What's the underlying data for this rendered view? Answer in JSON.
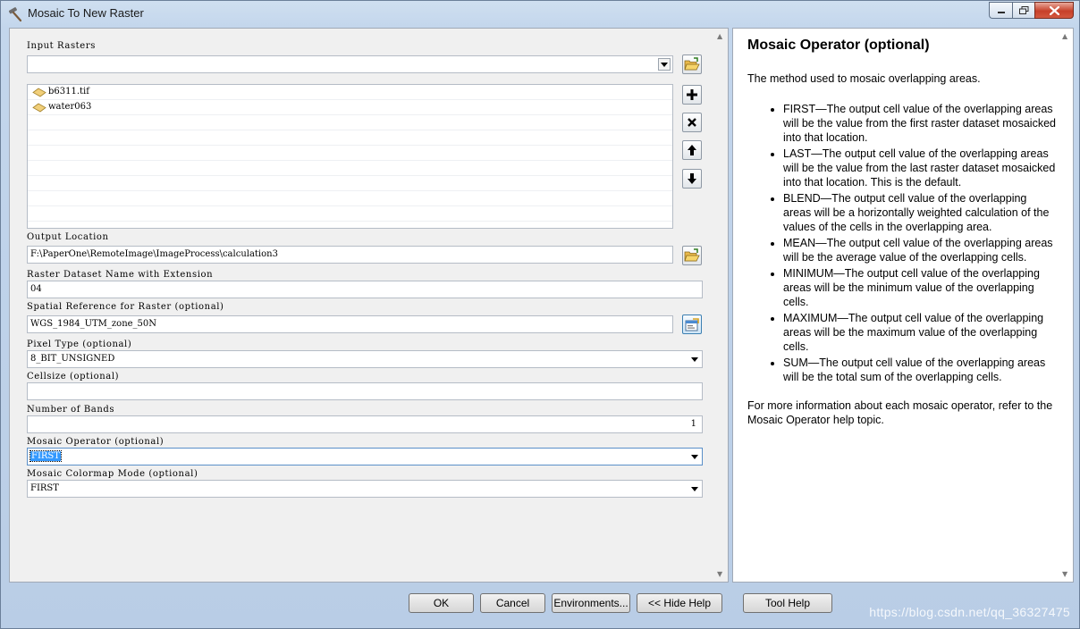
{
  "window": {
    "title": "Mosaic To New Raster"
  },
  "form": {
    "input_rasters": {
      "label": "Input Rasters",
      "value": "",
      "items": [
        {
          "name": "b6311.tif"
        },
        {
          "name": "water063"
        }
      ]
    },
    "output_location": {
      "label": "Output Location",
      "value": "F:\\PaperOne\\RemoteImage\\ImageProcess\\calculation3"
    },
    "raster_dataset_name": {
      "label": "Raster Dataset Name with Extension",
      "value": "04"
    },
    "spatial_reference": {
      "label": "Spatial Reference for Raster (optional)",
      "value": "WGS_1984_UTM_zone_50N"
    },
    "pixel_type": {
      "label": "Pixel Type (optional)",
      "value": "8_BIT_UNSIGNED"
    },
    "cellsize": {
      "label": "Cellsize (optional)",
      "value": ""
    },
    "number_of_bands": {
      "label": "Number of Bands",
      "value": "1"
    },
    "mosaic_operator": {
      "label": "Mosaic Operator (optional)",
      "value": "FIRST"
    },
    "mosaic_colormap_mode": {
      "label": "Mosaic Colormap Mode (optional)",
      "value": "FIRST"
    }
  },
  "help": {
    "title": "Mosaic Operator (optional)",
    "intro": "The method used to mosaic overlapping areas.",
    "items": [
      "FIRST—The output cell value of the overlapping areas will be the value from the first raster dataset mosaicked into that location.",
      "LAST—The output cell value of the overlapping areas will be the value from the last raster dataset mosaicked into that location. This is the default.",
      "BLEND—The output cell value of the overlapping areas will be a horizontally weighted calculation of the values of the cells in the overlapping area.",
      "MEAN—The output cell value of the overlapping areas will be the average value of the overlapping cells.",
      "MINIMUM—The output cell value of the overlapping areas will be the minimum value of the overlapping cells.",
      "MAXIMUM—The output cell value of the overlapping areas will be the maximum value of the overlapping cells.",
      "SUM—The output cell value of the overlapping areas will be the total sum of the overlapping cells."
    ],
    "footer": "For more information about each mosaic operator, refer to the Mosaic Operator help topic."
  },
  "buttons": {
    "ok": "OK",
    "cancel": "Cancel",
    "environments": "Environments...",
    "hide_help": "<< Hide Help",
    "tool_help": "Tool Help"
  },
  "watermark": "https://blog.csdn.net/qq_36327475",
  "colors": {
    "selection": "#3399ff",
    "close_button": "#c7402a",
    "folder": "#e8b84a"
  }
}
